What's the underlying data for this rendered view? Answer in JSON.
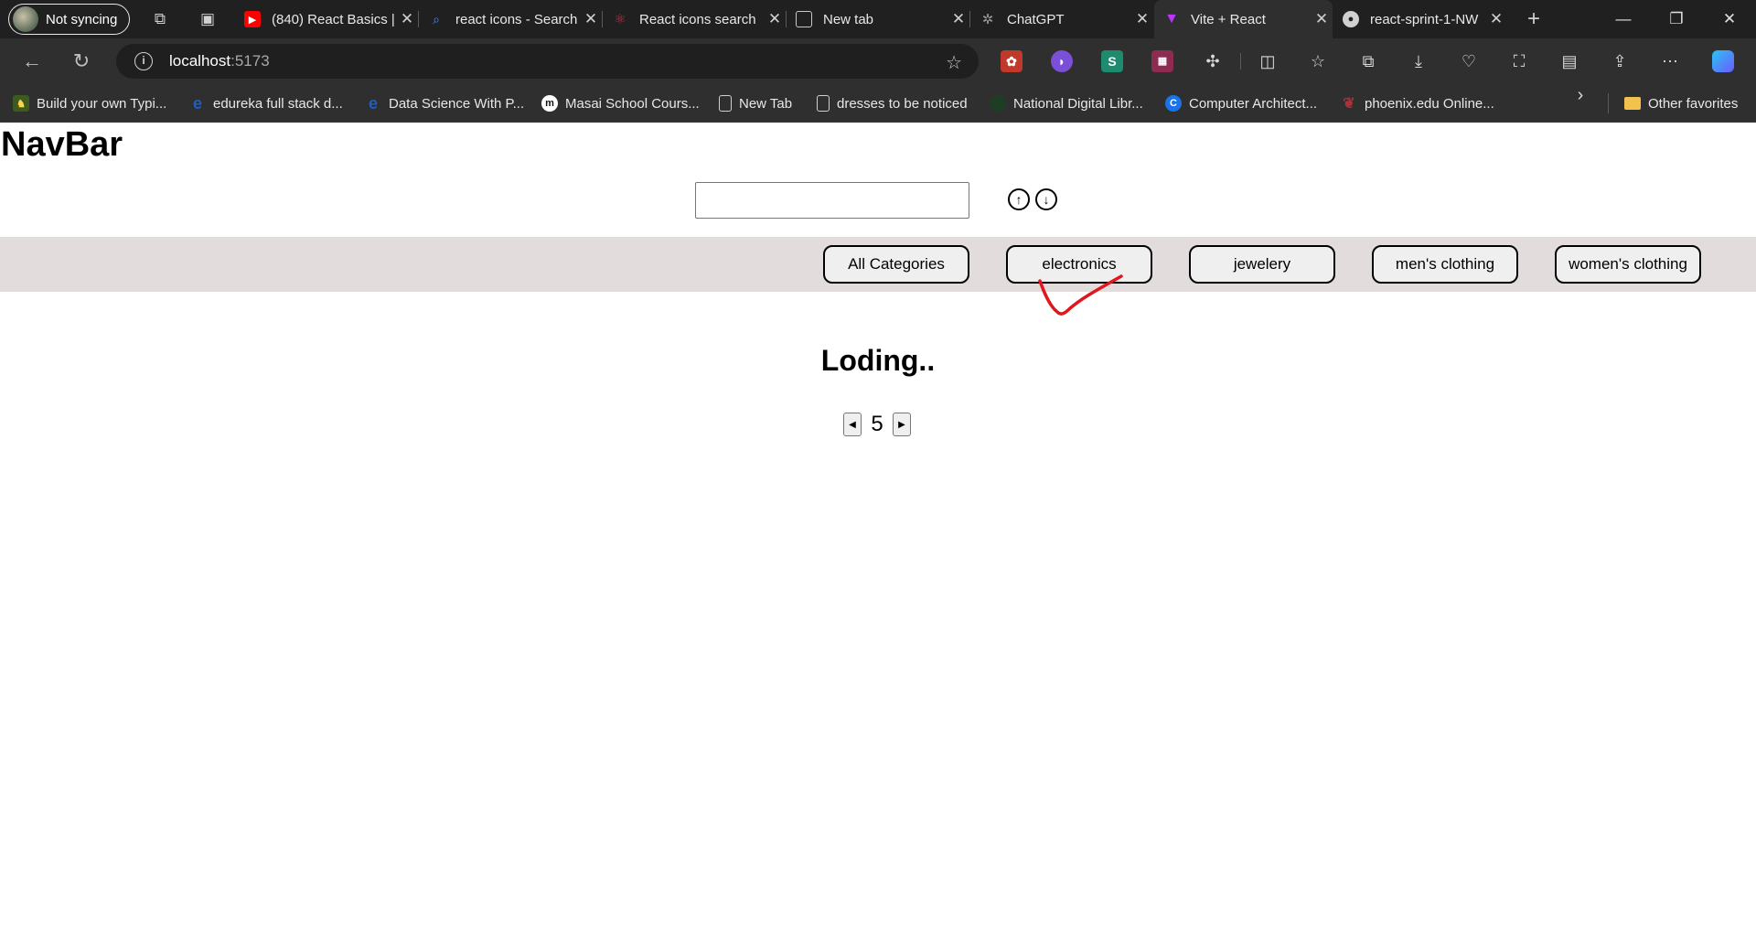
{
  "browser": {
    "profile_label": "Not syncing",
    "tabs": [
      {
        "title": "(840) React Basics |",
        "favicon": "youtube-icon",
        "color": "#ff0000"
      },
      {
        "title": "react icons - Search",
        "favicon": "search-icon",
        "color": "#4a8cff"
      },
      {
        "title": "React icons search",
        "favicon": "react-icon",
        "color": "#c0304a"
      },
      {
        "title": "New tab",
        "favicon": "newtab-icon",
        "color": "#d0d0d0"
      },
      {
        "title": "ChatGPT",
        "favicon": "chatgpt-icon",
        "color": "#808080"
      },
      {
        "title": "Vite + React",
        "favicon": "vite-icon",
        "color": "#bd34fe"
      },
      {
        "title": "react-sprint-1-NW",
        "favicon": "github-icon",
        "color": "#d0d0d0"
      }
    ],
    "address": {
      "host": "localhost",
      "port": ":5173"
    },
    "bookmarks": [
      {
        "label": "Build your own Typi...",
        "icon": "typing-icon",
        "color": "#6b8e23"
      },
      {
        "label": "edureka full stack d...",
        "icon": "edureka-icon",
        "color": "#1d5fbf"
      },
      {
        "label": "Data Science With P...",
        "icon": "edureka-icon",
        "color": "#1d5fbf"
      },
      {
        "label": "Masai School Cours...",
        "icon": "masai-icon",
        "color": "#ffffff"
      },
      {
        "label": "New Tab",
        "icon": "page-icon",
        "color": "#d0d0d0"
      },
      {
        "label": "dresses to be noticed",
        "icon": "page-icon",
        "color": "#d0d0d0"
      },
      {
        "label": "National Digital Libr...",
        "icon": "ndl-icon",
        "color": "#1e6b2e"
      },
      {
        "label": "Computer Architect...",
        "icon": "c-icon",
        "color": "#1a73e8"
      },
      {
        "label": "phoenix.edu Online...",
        "icon": "phoenix-icon",
        "color": "#b0303a"
      }
    ],
    "other_favorites": "Other favorites"
  },
  "app": {
    "brand": "NavBar",
    "search": {
      "value": "",
      "placeholder": ""
    },
    "categories": [
      "All Categories",
      "electronics",
      "jewelery",
      "men's clothing",
      "women's clothing"
    ],
    "status": "Loding..",
    "page": "5",
    "colors": {
      "category_bar": "#e2dcdc",
      "annotation": "#e0181e"
    }
  }
}
